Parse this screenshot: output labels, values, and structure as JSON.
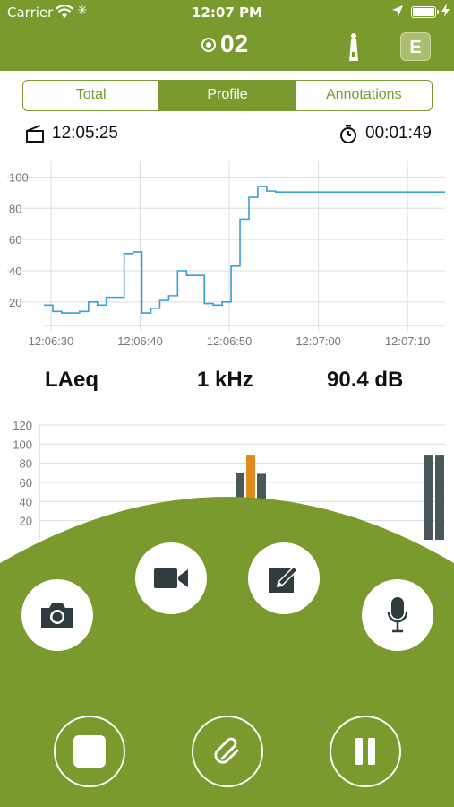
{
  "status_bar": {
    "carrier": "Carrier",
    "time": "12:07 PM"
  },
  "header": {
    "session_number": "02",
    "badge_letter": "E"
  },
  "tabs": [
    {
      "label": "Total",
      "active": false
    },
    {
      "label": "Profile",
      "active": true
    },
    {
      "label": "Annotations",
      "active": false
    }
  ],
  "info": {
    "start_time": "12:05:25",
    "elapsed": "00:01:49"
  },
  "readout": {
    "metric": "LAeq",
    "band": "1 kHz",
    "level": "90.4 dB"
  },
  "colors": {
    "brand_green": "#7a9a2e",
    "line_blue": "#3aa0d8",
    "bar_gray": "#4a5859",
    "bar_orange": "#e08a1e"
  },
  "icons": [
    "camera-icon",
    "video-icon",
    "note-icon",
    "microphone-icon",
    "stop-icon",
    "attach-icon",
    "pause-icon"
  ],
  "chart_data": [
    {
      "type": "line",
      "title": "",
      "xlabel": "",
      "ylabel": "",
      "xticks": [
        "12:06:30",
        "12:06:40",
        "12:06:50",
        "12:07:00",
        "12:07:10"
      ],
      "yticks": [
        "20",
        "40",
        "60",
        "80",
        "100"
      ],
      "ylim": [
        5,
        110
      ],
      "xlim": [
        0,
        45
      ],
      "grid": true,
      "series": [
        {
          "x": [
            0,
            1,
            2,
            3,
            4,
            5,
            6,
            7,
            8,
            9,
            10,
            11,
            12,
            13,
            14,
            15,
            16,
            17,
            18,
            19,
            20,
            21,
            22,
            23,
            24,
            25,
            26,
            45
          ],
          "y": [
            18,
            14,
            13,
            13,
            14,
            20,
            18,
            23,
            23,
            51,
            52,
            13,
            16,
            21,
            24,
            40,
            37,
            37,
            19,
            18,
            20,
            43,
            73,
            87,
            94,
            91,
            90.4,
            90.4
          ]
        }
      ]
    },
    {
      "type": "bar",
      "title": "",
      "yticks": [
        "20",
        "40",
        "60",
        "80",
        "100",
        "120"
      ],
      "ylim": [
        0,
        120
      ],
      "grid": true,
      "bars": [
        {
          "index": 0,
          "value": 70,
          "color": "gray"
        },
        {
          "index": 1,
          "value": 89,
          "color": "orange"
        },
        {
          "index": 2,
          "value": 69,
          "color": "gray"
        },
        {
          "index": 3,
          "value": 89,
          "color": "gray"
        },
        {
          "index": 4,
          "value": 89,
          "color": "gray"
        }
      ]
    }
  ]
}
